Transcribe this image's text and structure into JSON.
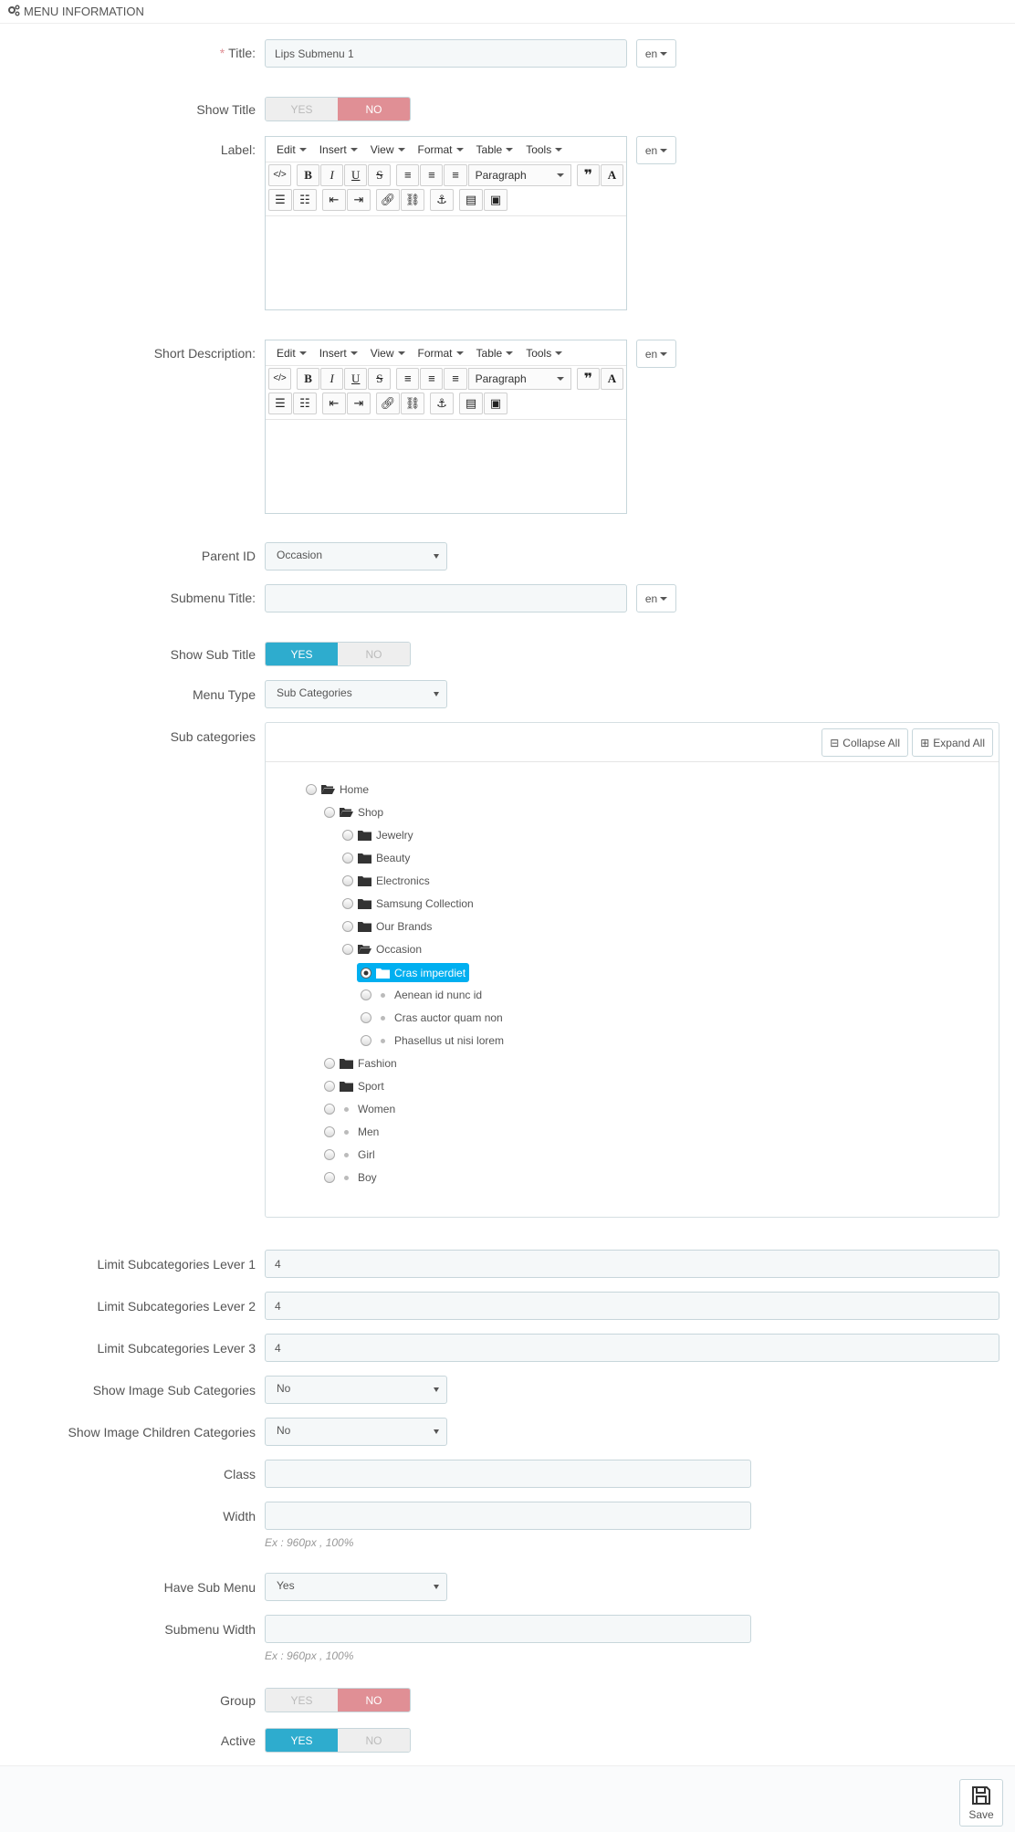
{
  "header": {
    "title": "MENU INFORMATION"
  },
  "fields": {
    "title": {
      "label": "Title:",
      "required": "*",
      "value": "Lips Submenu 1",
      "lang": "en"
    },
    "show_title": {
      "label": "Show Title",
      "yes": "YES",
      "no": "NO",
      "value": "NO"
    },
    "label": {
      "label": "Label:",
      "lang": "en"
    },
    "short_description": {
      "label": "Short Description:",
      "lang": "en"
    },
    "parent_id": {
      "label": "Parent ID",
      "value": "Occasion"
    },
    "submenu_title": {
      "label": "Submenu Title:",
      "value": "",
      "lang": "en"
    },
    "show_sub_title": {
      "label": "Show Sub Title",
      "yes": "YES",
      "no": "NO",
      "value": "YES"
    },
    "menu_type": {
      "label": "Menu Type",
      "value": "Sub Categories"
    },
    "sub_categories": {
      "label": "Sub categories",
      "collapse_all": "Collapse All",
      "expand_all": "Expand All"
    },
    "limit1": {
      "label": "Limit Subcategories Lever 1",
      "value": "4"
    },
    "limit2": {
      "label": "Limit Subcategories Lever 2",
      "value": "4"
    },
    "limit3": {
      "label": "Limit Subcategories Lever 3",
      "value": "4"
    },
    "show_image_sub": {
      "label": "Show Image Sub Categories",
      "value": "No"
    },
    "show_image_children": {
      "label": "Show Image Children Categories",
      "value": "No"
    },
    "class": {
      "label": "Class",
      "value": ""
    },
    "width": {
      "label": "Width",
      "value": "",
      "help": "Ex : 960px , 100%"
    },
    "have_sub_menu": {
      "label": "Have Sub Menu",
      "value": "Yes"
    },
    "submenu_width": {
      "label": "Submenu Width",
      "value": "",
      "help": "Ex : 960px , 100%"
    },
    "group": {
      "label": "Group",
      "yes": "YES",
      "no": "NO",
      "value": "NO"
    },
    "active": {
      "label": "Active",
      "yes": "YES",
      "no": "NO",
      "value": "YES"
    }
  },
  "editor": {
    "menus": [
      "Edit",
      "Insert",
      "View",
      "Format",
      "Table",
      "Tools"
    ],
    "block_format": "Paragraph"
  },
  "tree": {
    "home": "Home",
    "shop": "Shop",
    "jewelry": "Jewelry",
    "beauty": "Beauty",
    "electronics": "Electronics",
    "samsung": "Samsung Collection",
    "brands": "Our Brands",
    "occasion": "Occasion",
    "cras_imperdiet": "Cras imperdiet",
    "aenean": "Aenean id nunc id",
    "cras_auctor": "Cras auctor quam non",
    "phasellus": "Phasellus ut nisi lorem",
    "fashion": "Fashion",
    "sport": "Sport",
    "women": "Women",
    "men": "Men",
    "girl": "Girl",
    "boy": "Boy",
    "selected": "Cras imperdiet"
  },
  "footer": {
    "save": "Save"
  },
  "colors": {
    "yes_active": "#2eacce",
    "no_active": "#e08f95",
    "tree_selected": "#00aff0"
  }
}
